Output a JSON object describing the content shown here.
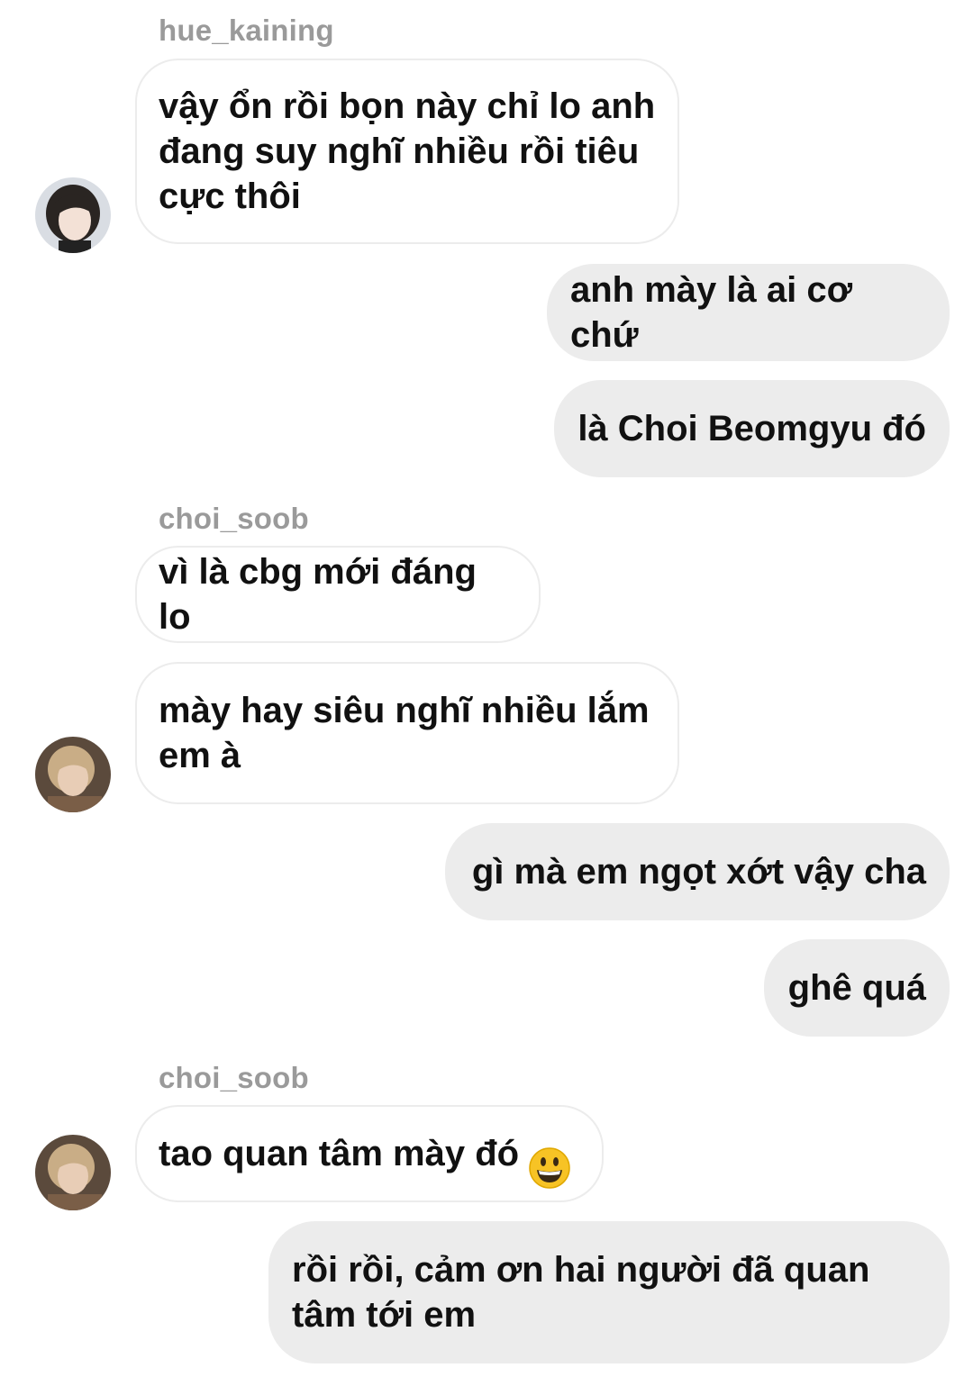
{
  "messages": [
    {
      "type": "username",
      "text": "hue_kaining"
    },
    {
      "type": "incoming",
      "text": "vậy ổn rồi bọn này chỉ lo anh\nđang suy nghĩ nhiều rồi tiêu\ncực thôi"
    },
    {
      "type": "outgoing",
      "text": "anh mày là ai cơ chứ"
    },
    {
      "type": "outgoing",
      "text": "là Choi Beomgyu đó"
    },
    {
      "type": "username",
      "text": "choi_soob"
    },
    {
      "type": "incoming",
      "text": "vì là cbg mới đáng lo"
    },
    {
      "type": "incoming",
      "text": "mày hay siêu nghĩ nhiều lắm\nem à"
    },
    {
      "type": "outgoing",
      "text": "gì mà em ngọt xớt vậy cha"
    },
    {
      "type": "outgoing",
      "text": "ghê quá"
    },
    {
      "type": "username",
      "text": "choi_soob"
    },
    {
      "type": "incoming",
      "text": "tao quan tâm mày đó",
      "emoji": "grinning-face-emoji"
    },
    {
      "type": "outgoing",
      "text": "rồi rồi, cảm ơn hai người đã quan\ntâm tới em"
    }
  ],
  "avatars": [
    {
      "name": "hue-kaining-avatar",
      "bg": "#d9dde3",
      "hair": "#2a2522",
      "skin": "#f3e1d6"
    },
    {
      "name": "choi-soob-avatar",
      "bg": "#5b4a3c",
      "hair": "#c9ad86",
      "skin": "#e8cdb6"
    },
    {
      "name": "choi-soob-avatar",
      "bg": "#5b4a3c",
      "hair": "#c9ad86",
      "skin": "#e8cdb6"
    }
  ],
  "colors": {
    "incoming_bubble": "#ffffff",
    "incoming_border": "#ececec",
    "outgoing_bubble": "#ececec",
    "username": "#9a9a9a",
    "text": "#111111"
  }
}
